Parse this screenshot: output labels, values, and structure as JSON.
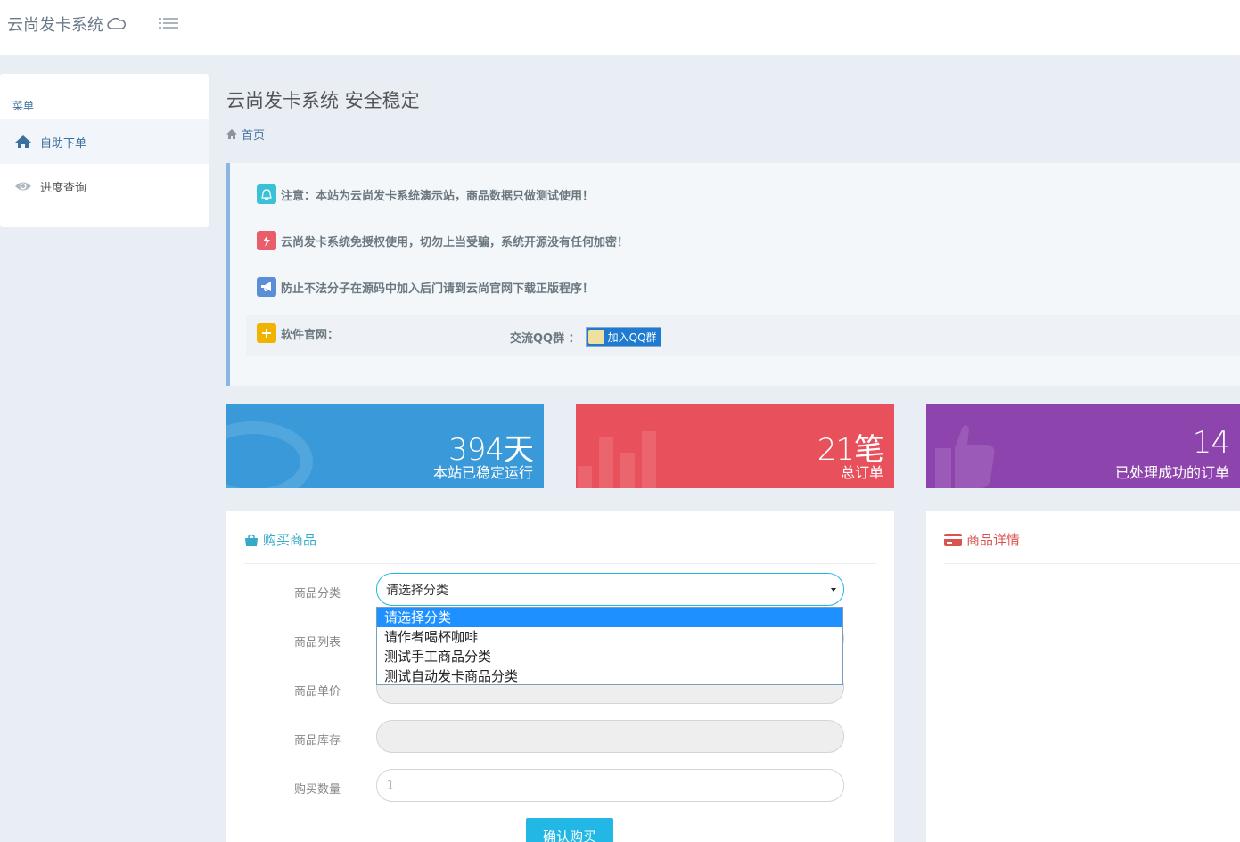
{
  "app": {
    "brand": "云尚发卡系统",
    "page_title": "云尚发卡系统 安全稳定",
    "breadcrumb": "首页"
  },
  "sidebar": {
    "header": "菜单",
    "items": [
      {
        "label": "自助下单",
        "icon": "home-icon",
        "active": true
      },
      {
        "label": "进度查询",
        "icon": "eye-icon",
        "active": false
      }
    ]
  },
  "notice": {
    "lines": [
      {
        "text": "注意：本站为云尚发卡系统演示站，商品数据只做测试使用！",
        "icon": "bell-icon",
        "color": "#3cc0d8"
      },
      {
        "text": "云尚发卡系统免授权使用，切勿上当受骗，系统开源没有任何加密！",
        "icon": "bolt-icon",
        "color": "#ea5d6a"
      },
      {
        "text": "防止不法分子在源码中加入后门请到云尚官网下载正版程序！",
        "icon": "megaphone-icon",
        "color": "#5b8ed6"
      }
    ],
    "website_label": "软件官网：",
    "qq_label": "交流QQ群 ：",
    "qq_button": "加入QQ群"
  },
  "stats": [
    {
      "value": "394天",
      "label": "本站已稳定运行",
      "color": "#3a9ad9"
    },
    {
      "value": "21笔",
      "label": "总订单",
      "color": "#e8505b"
    },
    {
      "value": "14",
      "label": "已处理成功的订单",
      "color": "#8e44ad"
    }
  ],
  "buy": {
    "title": "购买商品",
    "fields": {
      "category_label": "商品分类",
      "category_value": "请选择分类",
      "list_label": "商品列表",
      "price_label": "商品单价",
      "stock_label": "商品库存",
      "qty_label": "购买数量",
      "qty_value": "1"
    },
    "options": [
      "请选择分类",
      "请作者喝杯咖啡",
      "测试手工商品分类",
      "测试自动发卡商品分类"
    ],
    "submit": "确认购买"
  },
  "detail": {
    "title": "商品详情"
  }
}
